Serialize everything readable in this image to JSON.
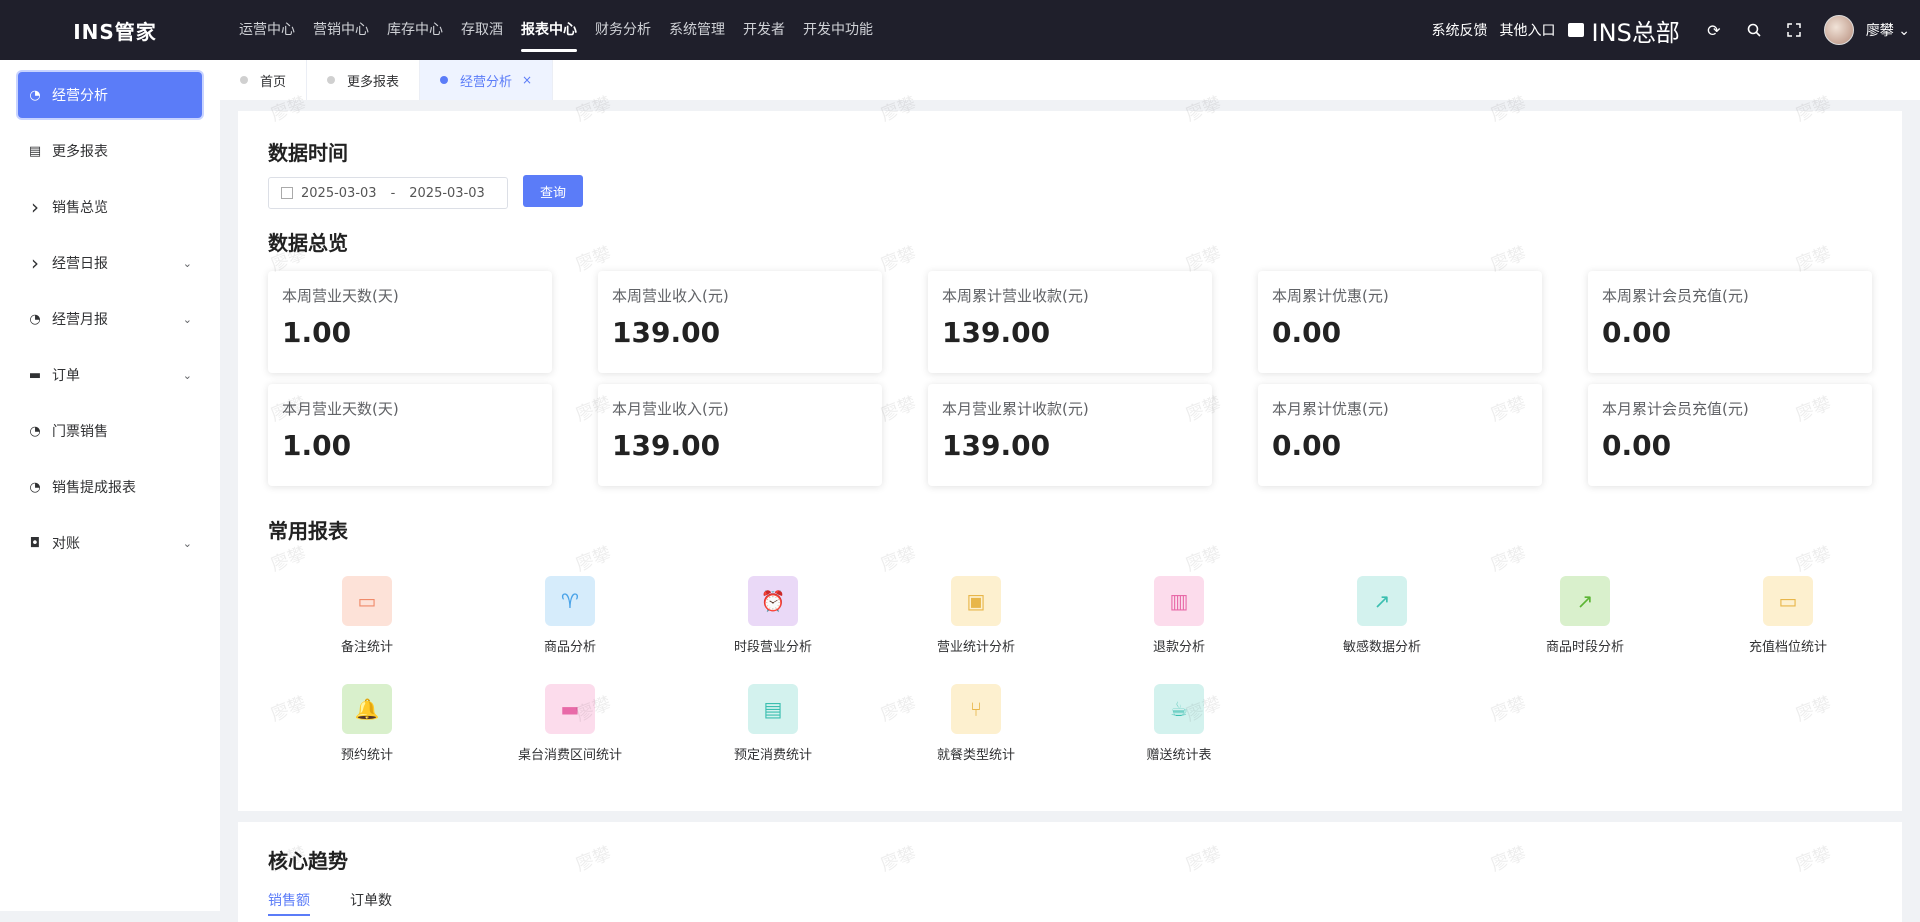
{
  "app": {
    "logo": "INS管家"
  },
  "topnav": [
    "运营中心",
    "营销中心",
    "库存中心",
    "存取酒",
    "报表中心",
    "财务分析",
    "系统管理",
    "开发者",
    "开发中功能"
  ],
  "topnav_active": "报表中心",
  "topright": {
    "feedback": "系统反馈",
    "other_entry": "其他入口",
    "store": "INS总部",
    "username": "廖攀"
  },
  "sidebar": [
    {
      "label": "经营分析",
      "icon": "pie-chart-icon",
      "active": true,
      "expandable": false
    },
    {
      "label": "更多报表",
      "icon": "document-icon",
      "active": false,
      "expandable": false
    },
    {
      "label": "销售总览",
      "icon": "chevron-right-icon",
      "active": false,
      "expandable": false
    },
    {
      "label": "经营日报",
      "icon": "chevron-right-icon",
      "active": false,
      "expandable": true
    },
    {
      "label": "经营月报",
      "icon": "pie-chart-icon",
      "active": false,
      "expandable": true
    },
    {
      "label": "订单",
      "icon": "printer-icon",
      "active": false,
      "expandable": true
    },
    {
      "label": "门票销售",
      "icon": "pie-chart-icon",
      "active": false,
      "expandable": false
    },
    {
      "label": "销售提成报表",
      "icon": "pie-chart-icon",
      "active": false,
      "expandable": false
    },
    {
      "label": "对账",
      "icon": "tag-icon",
      "active": false,
      "expandable": true
    }
  ],
  "tabs": [
    {
      "label": "首页",
      "active": false
    },
    {
      "label": "更多报表",
      "active": false
    },
    {
      "label": "经营分析",
      "active": true
    }
  ],
  "data_time": {
    "title": "数据时间",
    "start": "2025-03-03",
    "separator": "-",
    "end": "2025-03-03",
    "query_label": "查询"
  },
  "overview": {
    "title": "数据总览",
    "cards": [
      {
        "label": "本周营业天数(天)",
        "value": "1.00"
      },
      {
        "label": "本周营业收入(元)",
        "value": "139.00"
      },
      {
        "label": "本周累计营业收款(元)",
        "value": "139.00"
      },
      {
        "label": "本周累计优惠(元)",
        "value": "0.00"
      },
      {
        "label": "本周累计会员充值(元)",
        "value": "0.00"
      },
      {
        "label": "本月营业天数(天)",
        "value": "1.00"
      },
      {
        "label": "本月营业收入(元)",
        "value": "139.00"
      },
      {
        "label": "本月营业累计收款(元)",
        "value": "139.00"
      },
      {
        "label": "本月累计优惠(元)",
        "value": "0.00"
      },
      {
        "label": "本月累计会员充值(元)",
        "value": "0.00"
      }
    ]
  },
  "common_reports": {
    "title": "常用报表",
    "items": [
      {
        "label": "备注统计",
        "icon": "comment-icon",
        "bg": "#fde2d8",
        "fg": "#f08a6a"
      },
      {
        "label": "商品分析",
        "icon": "cup-icon",
        "bg": "#d6ecfb",
        "fg": "#4aa3e8"
      },
      {
        "label": "时段营业分析",
        "icon": "alarm-icon",
        "bg": "#ead9f7",
        "fg": "#a56ad8"
      },
      {
        "label": "营业统计分析",
        "icon": "board-icon",
        "bg": "#fdf0cf",
        "fg": "#e8b64a"
      },
      {
        "label": "退款分析",
        "icon": "presentation-icon",
        "bg": "#fcdcec",
        "fg": "#e86aa8"
      },
      {
        "label": "敏感数据分析",
        "icon": "trend-icon",
        "bg": "#d3f2ee",
        "fg": "#3bbfb0"
      },
      {
        "label": "商品时段分析",
        "icon": "chart-icon",
        "bg": "#d9f0cc",
        "fg": "#5cb534"
      },
      {
        "label": "充值档位统计",
        "icon": "card-icon",
        "bg": "#fdf0cf",
        "fg": "#e8b64a"
      },
      {
        "label": "预约统计",
        "icon": "bell-icon",
        "bg": "#d9f0cc",
        "fg": "#5cb534"
      },
      {
        "label": "桌台消费区间统计",
        "icon": "monitor-icon",
        "bg": "#fcdcec",
        "fg": "#e86aa8"
      },
      {
        "label": "预定消费统计",
        "icon": "book-icon",
        "bg": "#d3f2ee",
        "fg": "#3bbfb0"
      },
      {
        "label": "就餐类型统计",
        "icon": "cutlery-icon",
        "bg": "#fdf0cf",
        "fg": "#e8b64a"
      },
      {
        "label": "赠送统计表",
        "icon": "coffee-icon",
        "bg": "#d3f2ee",
        "fg": "#3bbfb0"
      }
    ]
  },
  "trend": {
    "title": "核心趋势",
    "tabs": [
      {
        "label": "销售额",
        "active": true
      },
      {
        "label": "订单数",
        "active": false
      }
    ]
  },
  "watermark": "廖攀",
  "colors": {
    "accent": "#5b7cf8",
    "topbar": "#1f1f2b"
  }
}
